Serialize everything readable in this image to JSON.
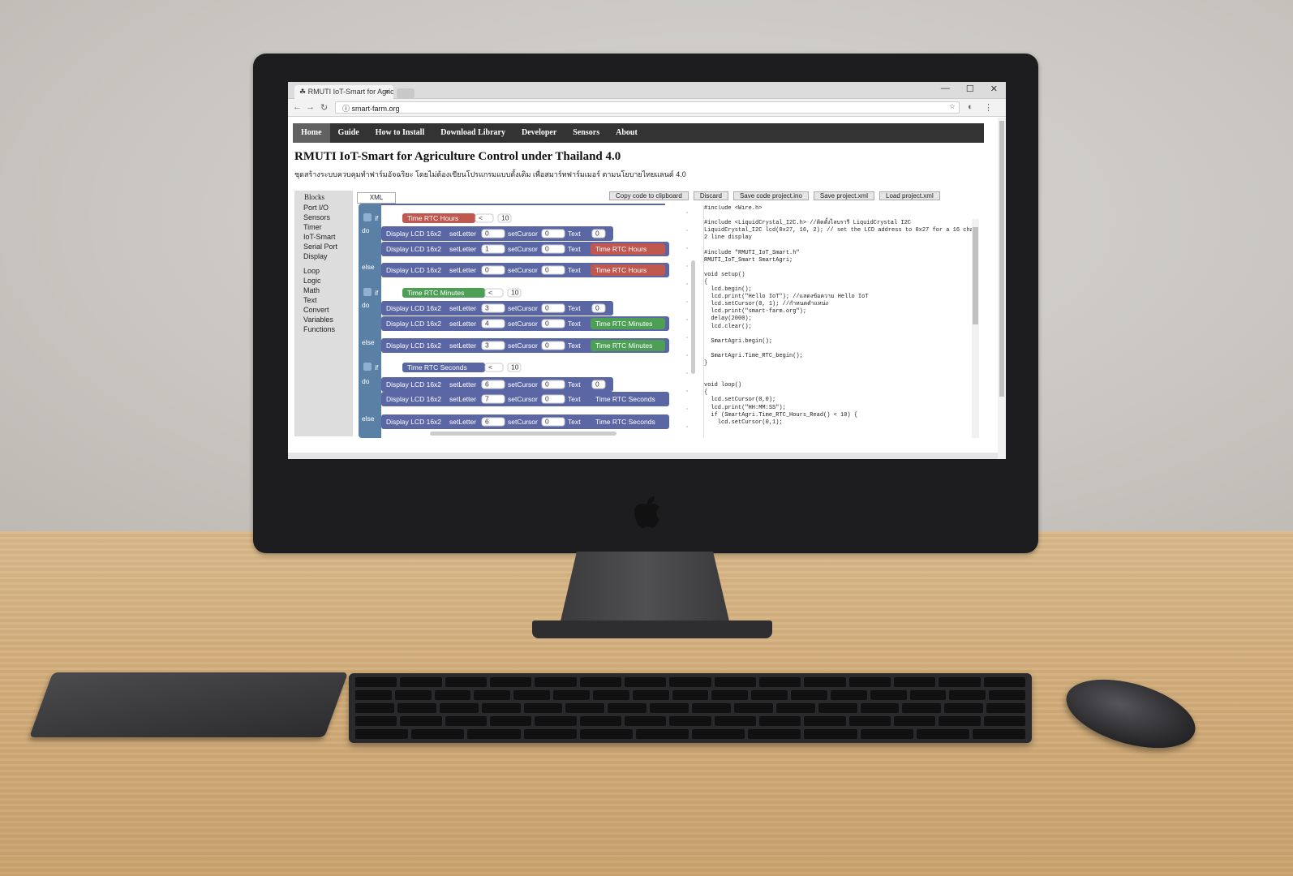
{
  "browser": {
    "tab_title": "RMUTI IoT-Smart for Agric",
    "tab_close": "×",
    "url": "smart-farm.org",
    "window_controls": [
      "—",
      "☐",
      "✕"
    ]
  },
  "menu": [
    "Home",
    "Guide",
    "How to Install",
    "Download Library",
    "Developer",
    "Sensors",
    "About"
  ],
  "page": {
    "title": "RMUTI IoT-Smart for Agriculture Control under Thailand 4.0",
    "subtitle": "ชุดสร้างระบบควบคุมทำฟาร์มอัจฉริยะ โดยไม่ต้องเขียนโปรแกรมแบบดั้งเดิม เพื่อสมาร์ทฟาร์มเมอร์ ตามนโยบายไทยแลนด์ 4.0"
  },
  "toolbox": {
    "header": "Blocks",
    "group1": [
      "Port I/O",
      "Sensors",
      "Timer",
      "IoT-Smart",
      "Serial Port",
      "Display"
    ],
    "group2": [
      "Loop",
      "Logic",
      "Math",
      "Text",
      "Convert",
      "Variables",
      "Functions"
    ]
  },
  "xml_tab": "XML",
  "buttons": [
    "Copy code to clipboard",
    "Discard",
    "Save code project.ino",
    "Save project.xml",
    "Load project.xml"
  ],
  "blocks": {
    "keywords": {
      "if": "if",
      "do": "do",
      "else": "else"
    },
    "display_lcd": "Display LCD 16x2",
    "set_letter": "setLetter",
    "set_cursor": "setCursor",
    "text": "Text",
    "conditions": [
      "Time RTC Hours",
      "Time RTC Minutes",
      "Time RTC Seconds"
    ],
    "op": "<",
    "cond_value": "10",
    "rows": [
      {
        "kw": "do",
        "val": "0",
        "cursor": "0",
        "text_block": "0",
        "type": "text"
      },
      {
        "kw": "",
        "val": "1",
        "cursor": "0",
        "text_block": "Time RTC Hours",
        "type": "hours"
      },
      {
        "kw": "else",
        "val": "0",
        "cursor": "0",
        "text_block": "Time RTC Hours",
        "type": "hours"
      },
      {
        "kw": "do",
        "val": "3",
        "cursor": "0",
        "text_block": "0",
        "type": "text"
      },
      {
        "kw": "",
        "val": "4",
        "cursor": "0",
        "text_block": "Time RTC Minutes",
        "type": "minutes"
      },
      {
        "kw": "else",
        "val": "3",
        "cursor": "0",
        "text_block": "Time RTC Minutes",
        "type": "minutes"
      },
      {
        "kw": "do",
        "val": "6",
        "cursor": "0",
        "text_block": "0",
        "type": "text"
      },
      {
        "kw": "",
        "val": "7",
        "cursor": "0",
        "text_block": "Time RTC Seconds",
        "type": "seconds"
      },
      {
        "kw": "else",
        "val": "6",
        "cursor": "0",
        "text_block": "Time RTC Seconds",
        "type": "seconds"
      }
    ]
  },
  "code": [
    "#include <Wire.h>",
    "",
    "#include <LiquidCrystal_I2C.h> //ติดตั้งไลบรารี LiquidCrystal I2C",
    "LiquidCrystal_I2C lcd(0x27, 16, 2); // set the LCD address to 0x27 for a 16 chars and",
    "2 line display",
    "",
    "#include \"RMUTI_IoT_Smart.h\"",
    "RMUTI_IoT_Smart SmartAgri;",
    "",
    "void setup()",
    "{",
    "  lcd.begin();",
    "  lcd.print(\"Hello IoT\"); //แสดงข้อความ Hello IoT",
    "  lcd.setCursor(0, 1); //กำหนดตำแหน่ง",
    "  lcd.print(\"smart-farm.org\");",
    "  delay(2000);",
    "  lcd.clear();",
    "",
    "  SmartAgri.begin();",
    "",
    "  SmartAgri.Time_RTC_begin();",
    "}",
    "",
    "",
    "void loop()",
    "{",
    "  lcd.setCursor(0,0);",
    "  lcd.print(\"HH:MM:SS\");",
    "  if (SmartAgri.Time_RTC_Hours_Read() < 10) {",
    "    lcd.setCursor(0,1);"
  ],
  "colors": {
    "menubar": "#333333",
    "block_lcd": "#5b67a5",
    "block_if": "#5b80a5",
    "hours": "#c0584f",
    "minutes": "#4c9f55",
    "seconds": "#5b67a5"
  }
}
